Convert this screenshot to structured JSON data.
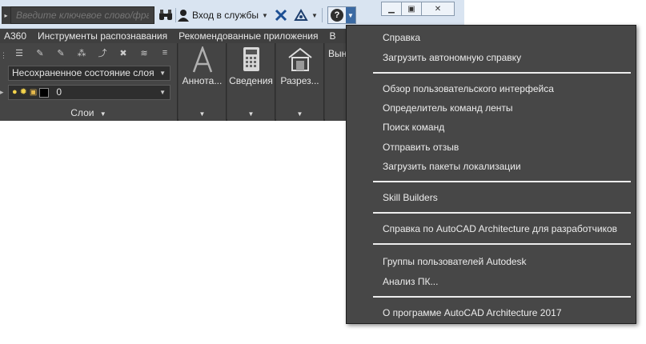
{
  "titlebar": {
    "search_placeholder": "Введите ключевое слово/фразу",
    "login_label": "Вход в службы",
    "icons": [
      "binoculars-icon",
      "user-icon",
      "exchange-x-icon",
      "a360-triangle-icon",
      "help-icon"
    ],
    "window_buttons": [
      "minimize",
      "restore",
      "close"
    ]
  },
  "tabs": [
    "A360",
    "Инструменты распознавания",
    "Рекомендованные приложения",
    "В"
  ],
  "ribbon": {
    "layer_state": "Несохраненное состояние слоя",
    "layer_name": "0",
    "layers_panel_label": "Слои",
    "tools": [
      {
        "label": "Аннота...",
        "icon": "annotation-a-icon"
      },
      {
        "label": "Сведения",
        "icon": "calculator-icon"
      },
      {
        "label": "Разрез...",
        "icon": "house-section-icon"
      },
      {
        "label": "Вын",
        "icon": ""
      }
    ]
  },
  "menu": {
    "items": [
      "Справка",
      "Загрузить автономную справку",
      "Обзор пользовательского интерфейса",
      "Определитель команд ленты",
      "Поиск команд",
      "Отправить отзыв",
      "Загрузить пакеты локализации",
      "Skill Builders",
      "Справка по AutoCAD Architecture для разработчиков",
      "Группы пользователей Autodesk",
      "Анализ ПК...",
      "О программе AutoCAD Architecture 2017"
    ]
  },
  "colors": {
    "menu_bg": "#474747",
    "ribbon_bg": "#3a3a3a",
    "titlebar_bg": "#d9e4f1",
    "accent": "#3b6aa3"
  }
}
